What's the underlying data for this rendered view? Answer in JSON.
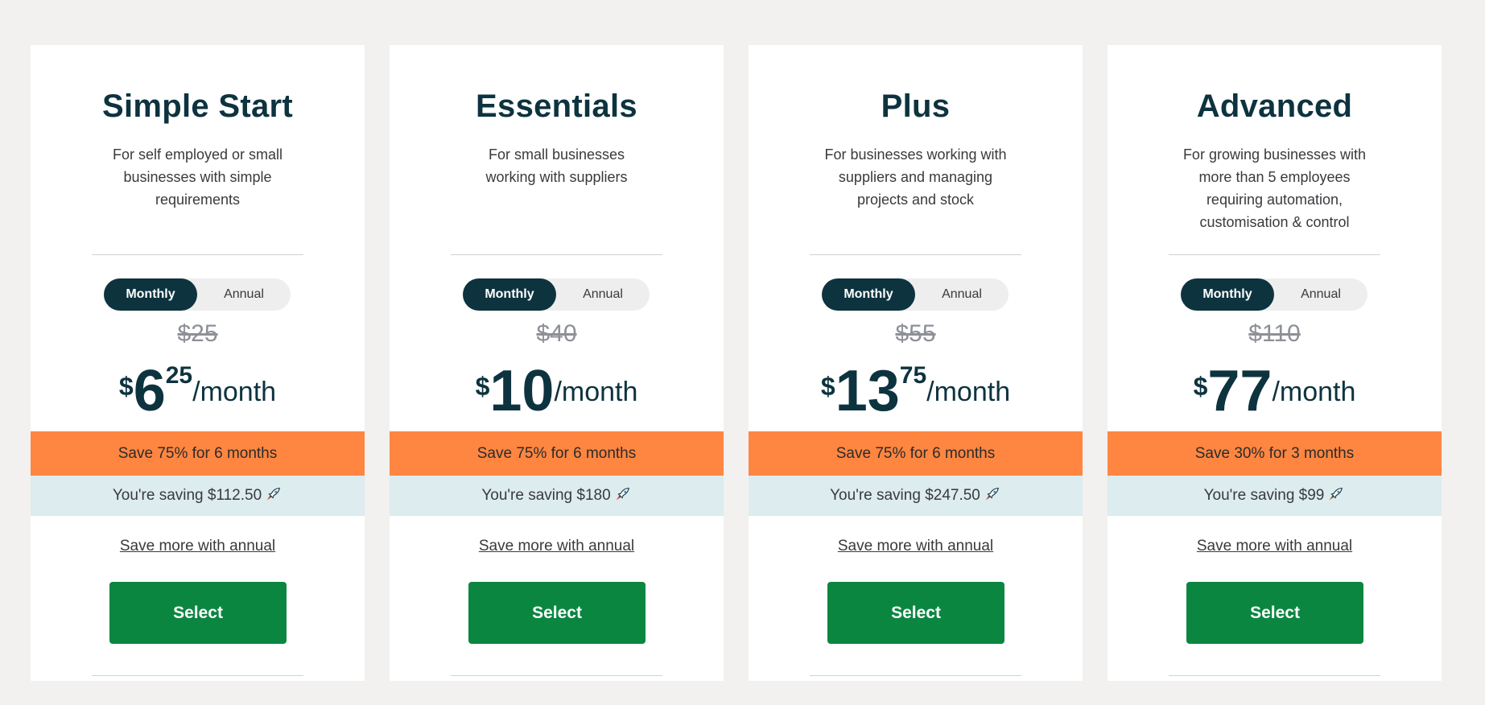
{
  "plans": [
    {
      "name": "Simple Start",
      "description": "For self employed or small\nbusinesses with simple\nrequirements",
      "toggle": {
        "monthly": "Monthly",
        "annual": "Annual",
        "selected": "Monthly"
      },
      "original_price": "$25",
      "price": {
        "currency": "$",
        "whole": "6",
        "cents": "25",
        "period": "/month"
      },
      "promo": "Save 75% for 6 months",
      "saving": "You're saving $112.50",
      "annual_link": "Save more with annual",
      "cta": "Select"
    },
    {
      "name": "Essentials",
      "description": "For small businesses\nworking with suppliers",
      "toggle": {
        "monthly": "Monthly",
        "annual": "Annual",
        "selected": "Monthly"
      },
      "original_price": "$40",
      "price": {
        "currency": "$",
        "whole": "10",
        "cents": "",
        "period": "/month"
      },
      "promo": "Save 75% for 6 months",
      "saving": "You're saving $180",
      "annual_link": "Save more with annual",
      "cta": "Select"
    },
    {
      "name": "Plus",
      "description": "For businesses working with\nsuppliers and managing\nprojects and stock",
      "toggle": {
        "monthly": "Monthly",
        "annual": "Annual",
        "selected": "Monthly"
      },
      "original_price": "$55",
      "price": {
        "currency": "$",
        "whole": "13",
        "cents": "75",
        "period": "/month"
      },
      "promo": "Save 75% for 6 months",
      "saving": "You're saving $247.50",
      "annual_link": "Save more with annual",
      "cta": "Select"
    },
    {
      "name": "Advanced",
      "description": "For growing businesses with\nmore than 5 employees\nrequiring automation,\ncustomisation & control",
      "toggle": {
        "monthly": "Monthly",
        "annual": "Annual",
        "selected": "Monthly"
      },
      "original_price": "$110",
      "price": {
        "currency": "$",
        "whole": "77",
        "cents": "",
        "period": "/month"
      },
      "promo": "Save 30% for 3 months",
      "saving": "You're saving $99",
      "annual_link": "Save more with annual",
      "cta": "Select"
    }
  ],
  "icons": {
    "saving_icon": "rocket-icon"
  },
  "colors": {
    "page_bg": "#f2f1ef",
    "heading": "#0d333f",
    "promo_bg": "#ff8641",
    "saving_bg": "#dcecef",
    "cta_bg": "#0b8641",
    "toggle_active": "#0d333f"
  }
}
